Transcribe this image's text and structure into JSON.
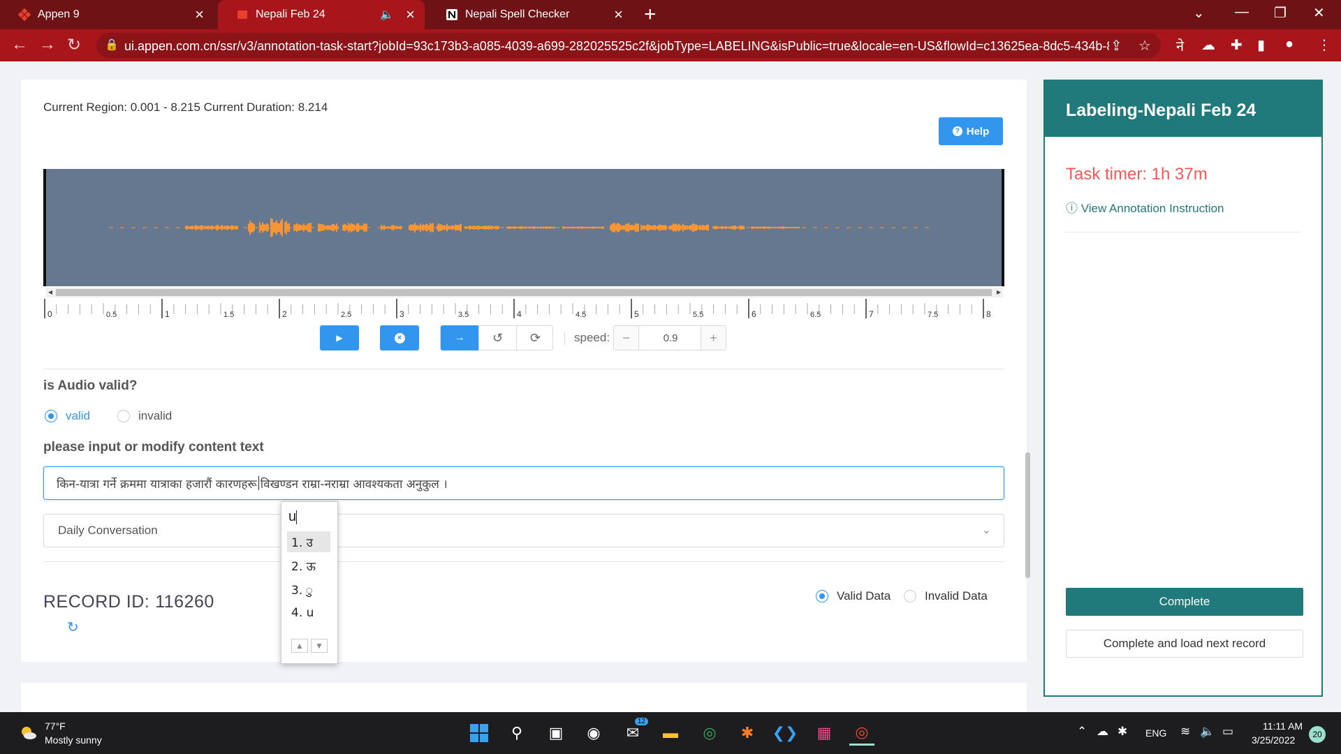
{
  "browser": {
    "tabs": [
      {
        "title": "Appen 9",
        "active": false
      },
      {
        "title": "Nepali Feb 24",
        "active": true,
        "audio": true
      },
      {
        "title": "Nepali Spell Checker",
        "active": false
      }
    ],
    "url": "ui.appen.com.cn/ssr/v3/annotation-task-start?jobId=93c173b3-a085-4039-a699-282025525c2f&jobType=LABELING&isPublic=true&locale=en-US&flowId=c13625ea-8dc5-434b-8..."
  },
  "editor": {
    "region_info": "Current Region: 0.001 - 8.215 Current Duration: 8.214",
    "help_label": "Help",
    "ruler_labels": [
      "0",
      "0.5",
      "1",
      "1.5",
      "2",
      "2.5",
      "3",
      "3.5",
      "4",
      "4.5",
      "5",
      "5.5",
      "6",
      "6.5",
      "7",
      "7.5",
      "8"
    ],
    "speed_label": "speed:",
    "speed_value": "0.9",
    "minus": "−",
    "plus": "+"
  },
  "form": {
    "audio_question": "is Audio valid?",
    "valid_label": "valid",
    "invalid_label": "invalid",
    "audio_selected": "valid",
    "text_question": "please input or modify content text",
    "content_before_caret": "किन-यात्रा गर्ने क्रममा यात्राका हजारौं कारणहरू ",
    "content_after_caret": "विखण्डन राम्रा-नराम्रा आवश्यकता अनुकुल ।",
    "category": "Daily Conversation",
    "record_id_label": "RECORD ID:",
    "record_id": "116260",
    "valid_data_label": "Valid Data",
    "invalid_data_label": "Invalid Data",
    "data_selected": "Valid Data"
  },
  "ime": {
    "input": "u",
    "candidates": [
      "1. उ",
      "2. ऊ",
      "3. ु",
      "4. u"
    ],
    "selected_index": 0
  },
  "side_panel": {
    "title": "Labeling-Nepali Feb 24",
    "timer": "Task timer: 1h 37m",
    "instruction_link": "View Annotation Instruction",
    "complete_label": "Complete",
    "complete_next_label": "Complete and load next record"
  },
  "taskbar": {
    "temperature": "77°F",
    "weather": "Mostly sunny",
    "mail_badge": "12",
    "language": "ENG",
    "time": "11:11 AM",
    "date": "3/25/2022",
    "notifications": "20"
  },
  "colors": {
    "browser_frame": "#a8161c",
    "accent_blue": "#3296ef",
    "panel_teal": "#20797a",
    "timer_red": "#ef5a56",
    "waveform_bg": "#66788f",
    "waveform_fg": "#f79433"
  }
}
